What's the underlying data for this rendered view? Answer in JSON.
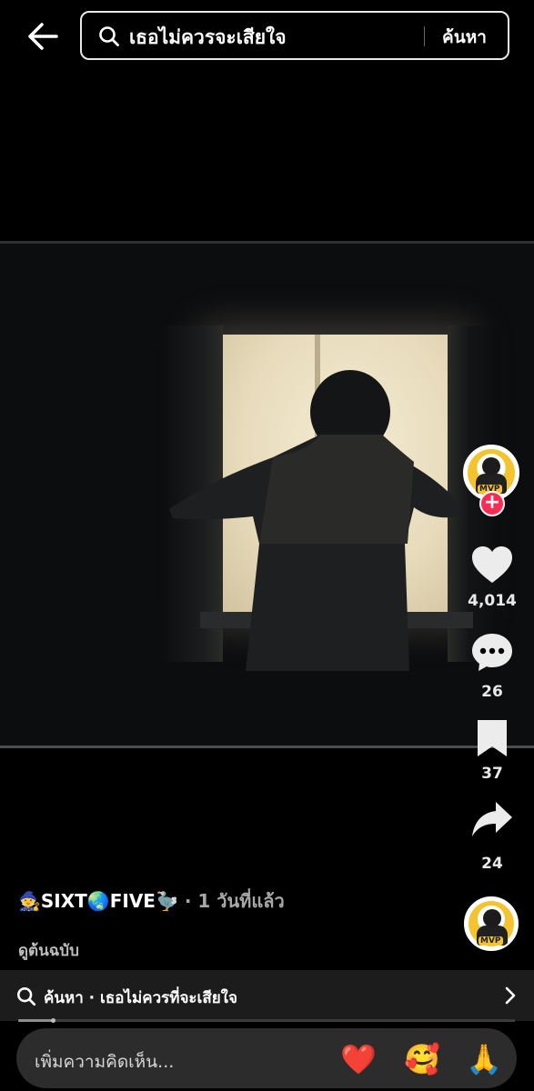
{
  "header": {
    "search_query": "เธอไม่ควรจะเสียใจ",
    "search_button": "ค้นหา"
  },
  "video": {
    "scene": "silhouette-at-window"
  },
  "actions": {
    "likes": "4,014",
    "comments": "26",
    "saves": "37",
    "shares": "24"
  },
  "post": {
    "author": "🧙SIXT🌏FIVE🦤",
    "time": " · 1 วันที่แล้ว",
    "view_original": "ดูต้นฉบับ",
    "avatar_badge": "MVP"
  },
  "related_search": {
    "text": "ค้นหา · เธอไม่ควรที่จะเสียใจ"
  },
  "playback": {
    "progress_fraction": 0.07
  },
  "comment_bar": {
    "placeholder": "เพิ่มความคิดเห็น...",
    "quick_emojis": [
      "❤️",
      "🥰",
      "🙏"
    ]
  },
  "colors": {
    "accent": "#fe2c55",
    "background": "#000000",
    "bar": "#1c1c1c"
  }
}
